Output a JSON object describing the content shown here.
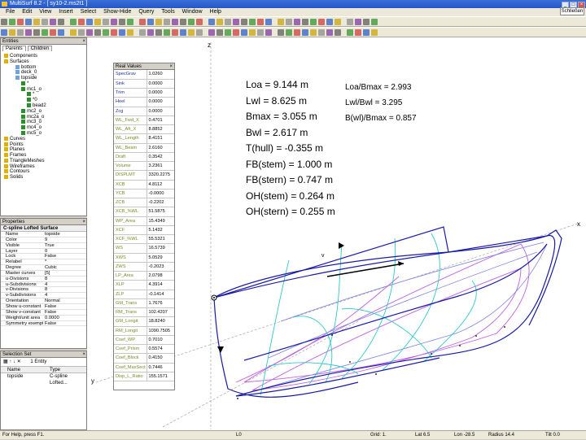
{
  "window": {
    "title": "MultiSurf 8.2 - [ sy10-2.ms2t1 ]",
    "close_chip": "Schließen"
  },
  "menu": [
    "File",
    "Edit",
    "View",
    "Insert",
    "Select",
    "Show-Hide",
    "Query",
    "Tools",
    "Window",
    "Help"
  ],
  "entities_panel": {
    "title": "Entities",
    "tabs": [
      "Parents",
      "Children"
    ],
    "tree": [
      {
        "label": "Components",
        "indent": 0
      },
      {
        "label": "Surfaces",
        "indent": 0
      },
      {
        "label": "bottom",
        "indent": 2
      },
      {
        "label": "deck_0",
        "indent": 2
      },
      {
        "label": "topside",
        "indent": 2
      },
      {
        "label": "*",
        "indent": 3
      },
      {
        "label": "mc1_o",
        "indent": 3
      },
      {
        "label": "*",
        "indent": 4
      },
      {
        "label": "*0",
        "indent": 4
      },
      {
        "label": "bead2",
        "indent": 4
      },
      {
        "label": "mc2_o",
        "indent": 3
      },
      {
        "label": "mc2a_o",
        "indent": 3
      },
      {
        "label": "mc3_o",
        "indent": 3
      },
      {
        "label": "mc4_o",
        "indent": 3
      },
      {
        "label": "mc5_o",
        "indent": 3
      },
      {
        "label": "Curves",
        "indent": 0
      },
      {
        "label": "Points",
        "indent": 0
      },
      {
        "label": "Planes",
        "indent": 0
      },
      {
        "label": "Frames",
        "indent": 0
      },
      {
        "label": "TriangleMeshes",
        "indent": 0
      },
      {
        "label": "Wireframes",
        "indent": 0
      },
      {
        "label": "Contours",
        "indent": 0
      },
      {
        "label": "Solids",
        "indent": 0
      }
    ]
  },
  "properties_panel": {
    "title": "Properties",
    "header": "C-spline Lofted Surface",
    "rows": [
      {
        "k": "Name",
        "v": "topside"
      },
      {
        "k": "Color",
        "v": "9"
      },
      {
        "k": "Visible",
        "v": "True"
      },
      {
        "k": "Layer",
        "v": "0"
      },
      {
        "k": "Lock",
        "v": "False"
      },
      {
        "k": "Relabel",
        "v": "*"
      },
      {
        "k": "Degree",
        "v": "Cubic"
      },
      {
        "k": "Master curves",
        "v": "[5]"
      },
      {
        "k": "u-Divisions",
        "v": "8"
      },
      {
        "k": "u-Subdivisions",
        "v": "4"
      },
      {
        "k": "v-Divisions",
        "v": "8"
      },
      {
        "k": "v-Subdivisions",
        "v": "4"
      },
      {
        "k": "Orientation",
        "v": "Normal"
      },
      {
        "k": "Show u-constant",
        "v": "False"
      },
      {
        "k": "Show v-constant",
        "v": "False"
      },
      {
        "k": "Weight/unit area",
        "v": "0.0000"
      },
      {
        "k": "Symmetry exempt",
        "v": "False"
      }
    ]
  },
  "selection_panel": {
    "title": "Selection Set",
    "count": "1 Entity",
    "columns": [
      "Name",
      "Type"
    ],
    "rows": [
      {
        "name": "topside",
        "type": "C-spline Lofted..."
      }
    ]
  },
  "real_values": {
    "title": "Real Values",
    "rows": [
      {
        "k": "SpecGrav",
        "v": "1.0260",
        "c": "blue"
      },
      {
        "k": "Sink",
        "v": "0.0000",
        "c": "blue"
      },
      {
        "k": "Trim",
        "v": "0.0000",
        "c": "blue"
      },
      {
        "k": "Heel",
        "v": "0.0000",
        "c": "blue"
      },
      {
        "k": "Zcg",
        "v": "0.0000",
        "c": "blue"
      },
      {
        "k": "WL_Fwd_X",
        "v": "0.4701",
        "c": "green"
      },
      {
        "k": "WL_Aft_X",
        "v": "8.8852",
        "c": "green"
      },
      {
        "k": "WL_Length",
        "v": "8.4151",
        "c": "green"
      },
      {
        "k": "WL_Beam",
        "v": "2.6160",
        "c": "green"
      },
      {
        "k": "Draft",
        "v": "0.3542",
        "c": "green"
      },
      {
        "k": "Volume",
        "v": "3.2361",
        "c": "green"
      },
      {
        "k": "DISPLMT",
        "v": "3320.2275",
        "c": "green"
      },
      {
        "k": "XCB",
        "v": "4.8112",
        "c": "green"
      },
      {
        "k": "YCB",
        "v": "-0.0000",
        "c": "green"
      },
      {
        "k": "ZCB",
        "v": "-0.2202",
        "c": "green"
      },
      {
        "k": "XCB_%WL",
        "v": "51.5875",
        "c": "green"
      },
      {
        "k": "WP_Area",
        "v": "15.4349",
        "c": "green"
      },
      {
        "k": "XCF",
        "v": "5.1432",
        "c": "green"
      },
      {
        "k": "XCF_%WL",
        "v": "55.5321",
        "c": "green"
      },
      {
        "k": "WS",
        "v": "16.5739",
        "c": "green"
      },
      {
        "k": "XWS",
        "v": "5.0529",
        "c": "green"
      },
      {
        "k": "ZWS",
        "v": "-0.2023",
        "c": "green"
      },
      {
        "k": "LP_Area",
        "v": "2.0798",
        "c": "green"
      },
      {
        "k": "XLP",
        "v": "4.3914",
        "c": "green"
      },
      {
        "k": "ZLP",
        "v": "-0.1414",
        "c": "green"
      },
      {
        "k": "GM_Trans",
        "v": "1.7676",
        "c": "green"
      },
      {
        "k": "RM_Trans",
        "v": "102.4207",
        "c": "green"
      },
      {
        "k": "GM_Longit",
        "v": "18.8240",
        "c": "green"
      },
      {
        "k": "RM_Longit",
        "v": "1090.7505",
        "c": "green"
      },
      {
        "k": "Coef_WP",
        "v": "0.7010",
        "c": "green"
      },
      {
        "k": "Coef_Prism",
        "v": "0.5574",
        "c": "green"
      },
      {
        "k": "Coef_Block",
        "v": "0.4150",
        "c": "green"
      },
      {
        "k": "Coef_MaxSect",
        "v": "0.7446",
        "c": "green"
      },
      {
        "k": "Disp_L_Ratio",
        "v": "155.1571",
        "c": "green"
      }
    ]
  },
  "annotations": {
    "params": [
      "Loa = 9.144 m",
      "Lwl = 8.625 m",
      "Bmax = 3.055 m",
      "Bwl = 2.617 m",
      "T(hull) = -0.355 m",
      "FB(stem) = 1.000 m",
      "FB(stern) = 0.747 m",
      "OH(stem) = 0.264 m",
      "OH(stern) = 0.255 m"
    ],
    "ratios": [
      "Loa/Bmax = 2.993",
      "Lwl/Bwl = 3.295",
      "B(wl)/Bmax = 0.857"
    ]
  },
  "axes": {
    "z": "z",
    "x": "x",
    "y": "y",
    "v": "v",
    "u": "u"
  },
  "status": {
    "help": "For Help, press F1.",
    "l0": "L0",
    "grid": "Grid: 1.",
    "lat": "Lat 6.5",
    "lon": "Lon -28.5",
    "radius": "Radius 14.4",
    "tilt": "Tilt 0.0"
  },
  "colors": {
    "hull": "#1a1aa8",
    "sections": "#30c8c8",
    "waterlines": "#c060e0",
    "buttocks": "#8080e0"
  }
}
